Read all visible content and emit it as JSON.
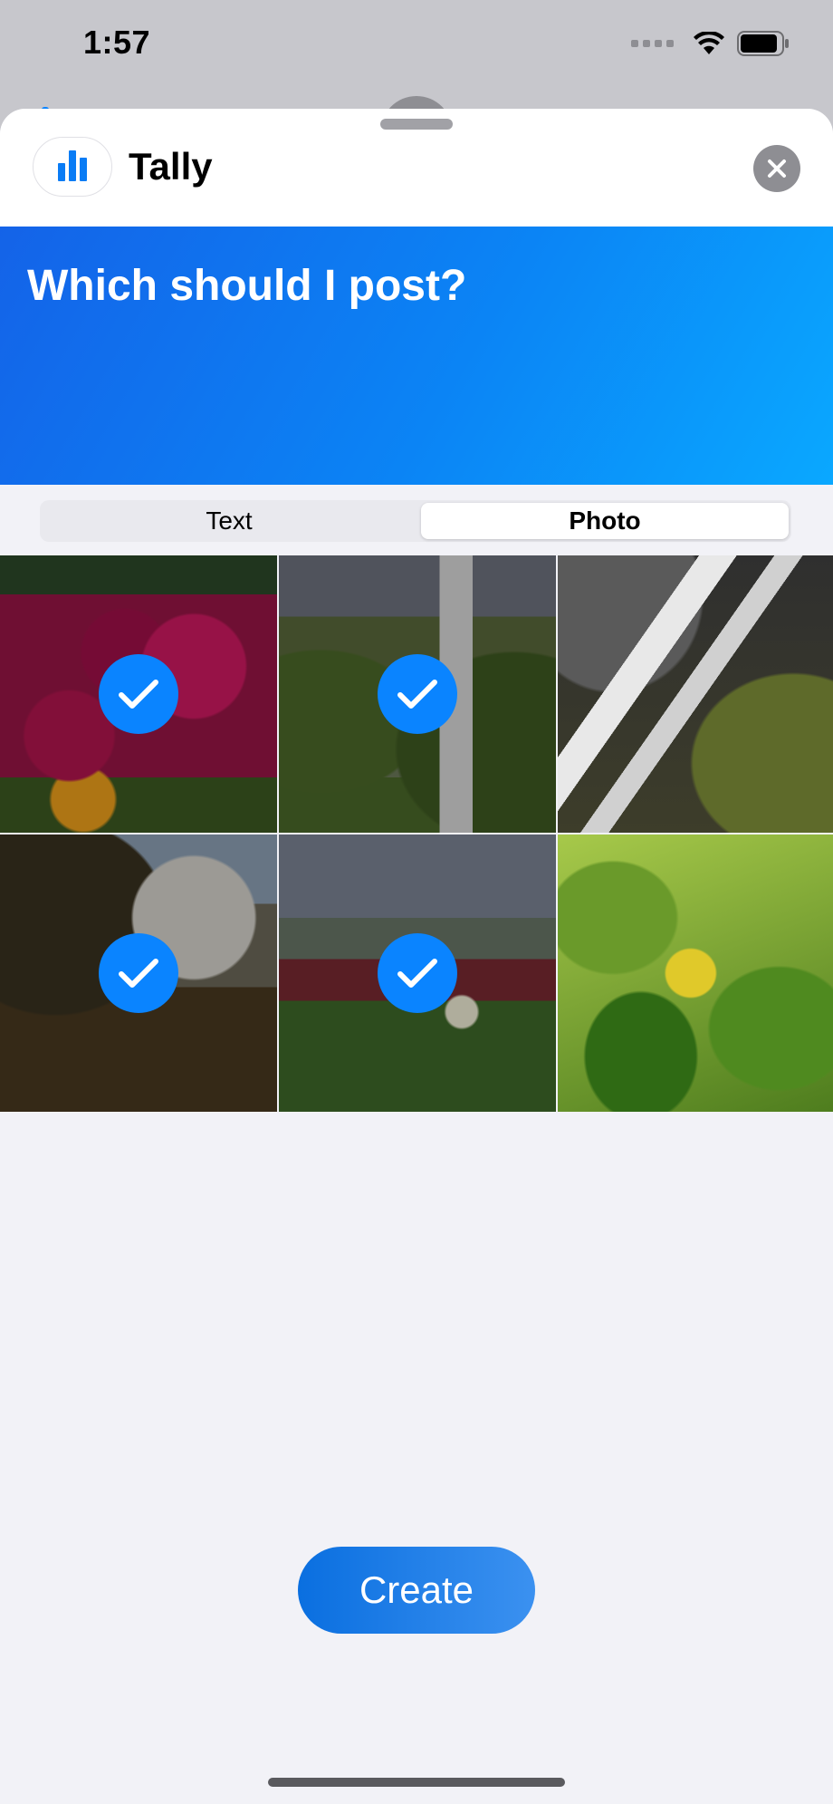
{
  "status_bar": {
    "time": "1:57",
    "icons": [
      "cellular-signal-icon",
      "wifi-icon",
      "battery-icon"
    ]
  },
  "header": {
    "app_name": "Tally",
    "app_icon": "bar-chart-icon",
    "close_icon": "close-icon"
  },
  "question": {
    "text": "Which should I post?"
  },
  "segmented_control": {
    "options": [
      {
        "label": "Text",
        "selected": false
      },
      {
        "label": "Photo",
        "selected": true
      }
    ]
  },
  "photos": [
    {
      "subject": "pink flowers",
      "selected": true
    },
    {
      "subject": "waterfall cliff",
      "selected": true
    },
    {
      "subject": "waterfall rocks",
      "selected": false
    },
    {
      "subject": "coastal waterfall",
      "selected": true
    },
    {
      "subject": "white flower in grass",
      "selected": true
    },
    {
      "subject": "green leaves",
      "selected": false
    }
  ],
  "actions": {
    "create_label": "Create"
  },
  "colors": {
    "accent": "#0a84ff",
    "sheet_background": "#f2f2f7",
    "question_gradient_start": "#1463e8",
    "question_gradient_end": "#0aa8ff"
  }
}
